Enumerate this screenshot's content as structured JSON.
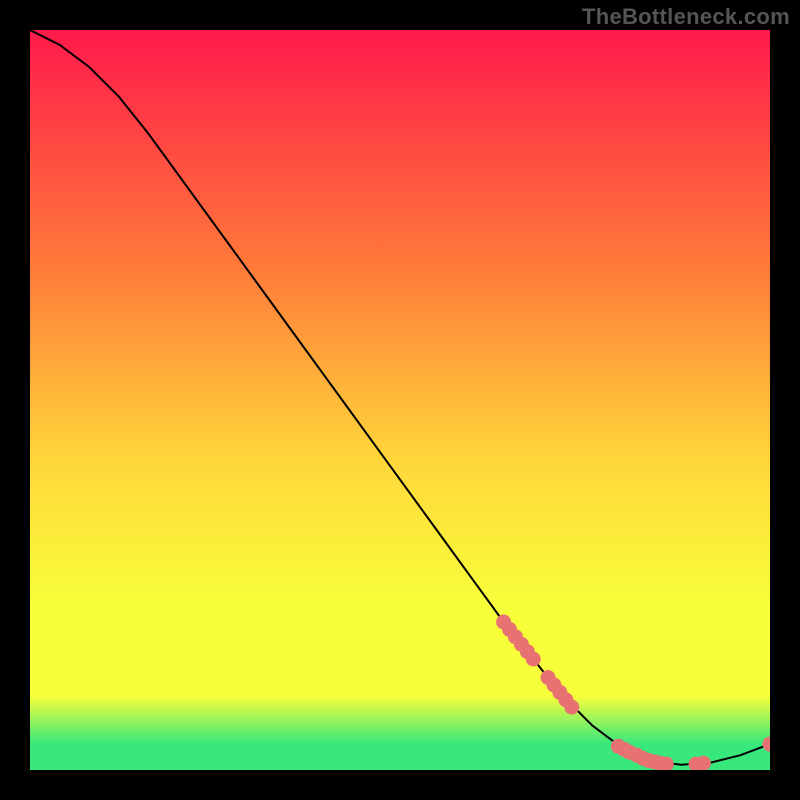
{
  "watermark": "TheBottleneck.com",
  "colors": {
    "bg": "#000000",
    "gradient_top": "#ff1a4b",
    "gradient_mid_upper": "#ff7a3a",
    "gradient_mid": "#ffd63a",
    "gradient_mid_lower": "#f7ff3a",
    "gradient_green": "#38e87d",
    "curve": "#000000",
    "marker_fill": "#e87272",
    "marker_stroke": "#c24f4f"
  },
  "chart_data": {
    "type": "line",
    "title": "",
    "xlabel": "",
    "ylabel": "",
    "xlim": [
      0,
      100
    ],
    "ylim": [
      0,
      100
    ],
    "grid": false,
    "legend_position": "none",
    "curve": [
      {
        "x": 0,
        "y": 100
      },
      {
        "x": 4,
        "y": 98
      },
      {
        "x": 8,
        "y": 95
      },
      {
        "x": 12,
        "y": 91
      },
      {
        "x": 16,
        "y": 86
      },
      {
        "x": 20,
        "y": 80.5
      },
      {
        "x": 24,
        "y": 75
      },
      {
        "x": 28,
        "y": 69.5
      },
      {
        "x": 32,
        "y": 64
      },
      {
        "x": 36,
        "y": 58.5
      },
      {
        "x": 40,
        "y": 53
      },
      {
        "x": 44,
        "y": 47.5
      },
      {
        "x": 48,
        "y": 42
      },
      {
        "x": 52,
        "y": 36.5
      },
      {
        "x": 56,
        "y": 31
      },
      {
        "x": 60,
        "y": 25.5
      },
      {
        "x": 64,
        "y": 20
      },
      {
        "x": 68,
        "y": 15
      },
      {
        "x": 72,
        "y": 10
      },
      {
        "x": 76,
        "y": 6
      },
      {
        "x": 80,
        "y": 3
      },
      {
        "x": 84,
        "y": 1.2
      },
      {
        "x": 88,
        "y": 0.7
      },
      {
        "x": 92,
        "y": 1.0
      },
      {
        "x": 96,
        "y": 2.0
      },
      {
        "x": 100,
        "y": 3.5
      }
    ],
    "markers": [
      {
        "x": 64.0,
        "y": 20.0
      },
      {
        "x": 64.8,
        "y": 19.0
      },
      {
        "x": 65.6,
        "y": 18.0
      },
      {
        "x": 66.4,
        "y": 17.0
      },
      {
        "x": 67.2,
        "y": 16.0
      },
      {
        "x": 68.0,
        "y": 15.0
      },
      {
        "x": 70.0,
        "y": 12.5
      },
      {
        "x": 70.8,
        "y": 11.5
      },
      {
        "x": 71.6,
        "y": 10.5
      },
      {
        "x": 72.4,
        "y": 9.5
      },
      {
        "x": 73.2,
        "y": 8.5
      },
      {
        "x": 79.5,
        "y": 3.2
      },
      {
        "x": 80.3,
        "y": 2.8
      },
      {
        "x": 81.0,
        "y": 2.4
      },
      {
        "x": 82.0,
        "y": 2.0
      },
      {
        "x": 82.8,
        "y": 1.6
      },
      {
        "x": 83.6,
        "y": 1.3
      },
      {
        "x": 84.4,
        "y": 1.1
      },
      {
        "x": 85.2,
        "y": 0.9
      },
      {
        "x": 86.0,
        "y": 0.8
      },
      {
        "x": 90.0,
        "y": 0.8
      },
      {
        "x": 91.0,
        "y": 0.9
      },
      {
        "x": 100.0,
        "y": 3.5
      }
    ]
  }
}
